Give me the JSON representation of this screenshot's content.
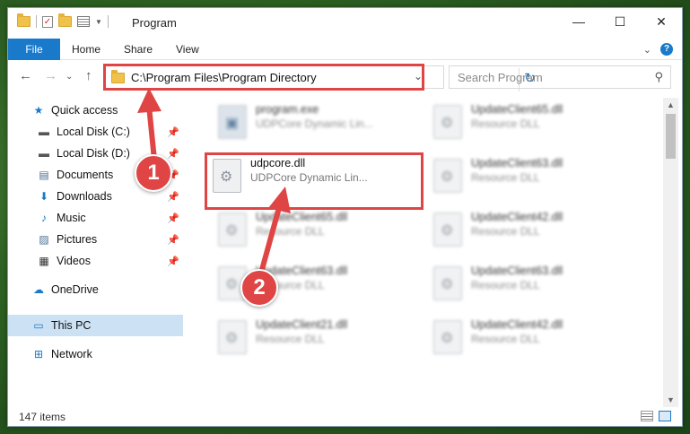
{
  "window": {
    "title": "Program",
    "controls": {
      "minimize": "—",
      "maximize": "☐",
      "close": "✕"
    }
  },
  "ribbon": {
    "tabs": [
      "File",
      "Home",
      "Share",
      "View"
    ],
    "help": "?"
  },
  "address": {
    "path": "C:\\Program Files\\Program Directory",
    "search_placeholder": "Search Program"
  },
  "sidebar": {
    "items": [
      {
        "label": "Quick access",
        "icon": "star-icon",
        "pinned": false
      },
      {
        "label": "Local Disk (C:)",
        "icon": "drive-icon",
        "pinned": true
      },
      {
        "label": "Local Disk (D:)",
        "icon": "drive-icon",
        "pinned": true
      },
      {
        "label": "Documents",
        "icon": "documents-icon",
        "pinned": true
      },
      {
        "label": "Downloads",
        "icon": "download-icon",
        "pinned": true
      },
      {
        "label": "Music",
        "icon": "music-icon",
        "pinned": true
      },
      {
        "label": "Pictures",
        "icon": "pictures-icon",
        "pinned": true
      },
      {
        "label": "Videos",
        "icon": "videos-icon",
        "pinned": true
      },
      {
        "label": "OneDrive",
        "icon": "cloud-icon",
        "pinned": false
      },
      {
        "label": "This PC",
        "icon": "pc-icon",
        "pinned": false,
        "selected": true
      },
      {
        "label": "Network",
        "icon": "network-icon",
        "pinned": false
      }
    ]
  },
  "files": [
    {
      "name": "program.exe",
      "desc": "UDPCore Dynamic Lin...",
      "type": "exe"
    },
    {
      "name": "UpdateClient65.dll",
      "desc": "Resource DLL",
      "type": "dll"
    },
    {
      "name": "udpcore.dll",
      "desc": "UDPCore Dynamic Lin...",
      "type": "dll",
      "highlighted": true
    },
    {
      "name": "UpdateClient63.dll",
      "desc": "Resource DLL",
      "type": "dll"
    },
    {
      "name": "UpdateClient65.dll",
      "desc": "Resource DLL",
      "type": "dll"
    },
    {
      "name": "UpdateClient42.dll",
      "desc": "Resource DLL",
      "type": "dll"
    },
    {
      "name": "UpdateClient63.dll",
      "desc": "Resource DLL",
      "type": "dll"
    },
    {
      "name": "UpdateClient63.dll",
      "desc": "Resource DLL",
      "type": "dll"
    },
    {
      "name": "UpdateClient21.dll",
      "desc": "Resource DLL",
      "type": "dll"
    },
    {
      "name": "UpdateClient42.dll",
      "desc": "Resource DLL",
      "type": "dll"
    }
  ],
  "status": {
    "items_count": "147 items"
  },
  "annotations": {
    "step1": "1",
    "step2": "2"
  },
  "colors": {
    "accent": "#1979ca",
    "highlight": "#e04545",
    "selected_nav": "#cce1f3"
  }
}
